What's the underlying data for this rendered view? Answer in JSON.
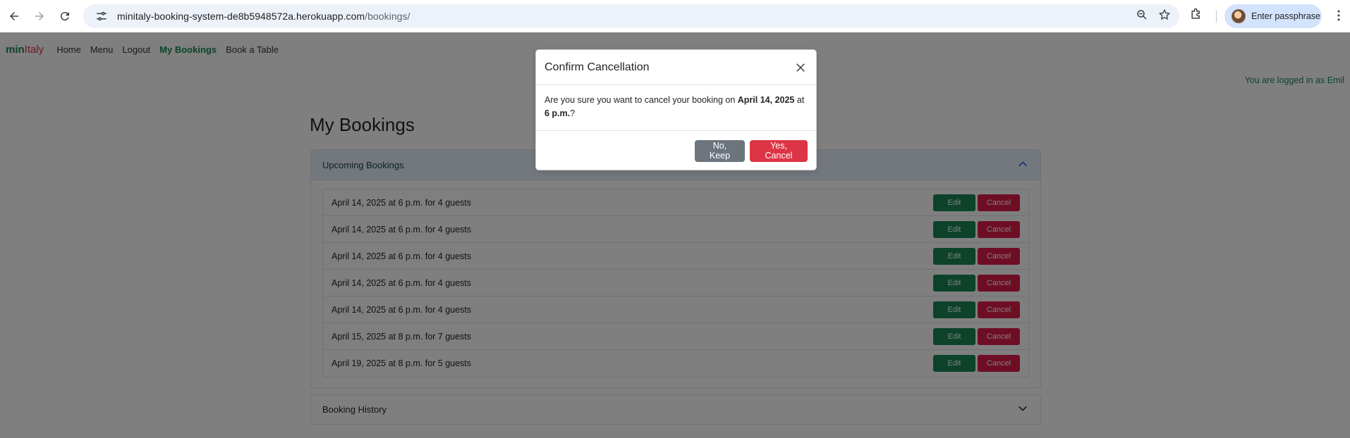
{
  "browser": {
    "url_host": "minitaly-booking-system-de8b5948572a.herokuapp.com",
    "url_path": "/bookings/",
    "profile_label": "Enter passphrase"
  },
  "site": {
    "brand_part1": "min",
    "brand_part2": "Italy",
    "nav": [
      "Home",
      "Menu",
      "Logout",
      "My Bookings",
      "Book a Table"
    ],
    "logged_in": "You are logged in as Emil"
  },
  "page": {
    "title": "My Bookings",
    "upcoming_header": "Upcoming Bookings",
    "history_header": "Booking History",
    "edit_label": "Edit",
    "cancel_label": "Cancel",
    "bookings": [
      "April 14, 2025 at 6 p.m. for 4 guests",
      "April 14, 2025 at 6 p.m. for 4 guests",
      "April 14, 2025 at 6 p.m. for 4 guests",
      "April 14, 2025 at 6 p.m. for 4 guests",
      "April 14, 2025 at 6 p.m. for 4 guests",
      "April 15, 2025 at 8 p.m. for 7 guests",
      "April 19, 2025 at 8 p.m. for 5 guests"
    ]
  },
  "modal": {
    "title": "Confirm Cancellation",
    "body_prefix": "Are you sure you want to cancel your booking on ",
    "body_date": "April 14, 2025",
    "body_mid": " at ",
    "body_time": "6 p.m.",
    "body_suffix": "?",
    "no_label": "No, Keep",
    "yes_label": "Yes, Cancel"
  },
  "colors": {
    "brand_green": "#198754",
    "brand_red": "#dc3545",
    "cancel_red": "#dc1c4b",
    "secondary_gray": "#6c757d"
  }
}
